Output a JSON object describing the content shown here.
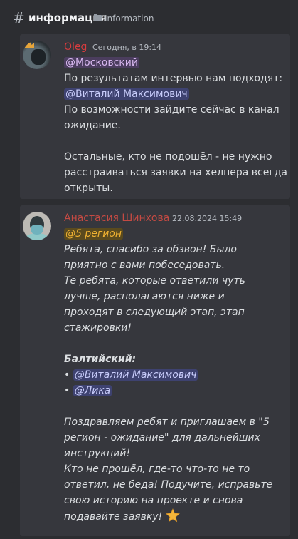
{
  "header": {
    "hash": "#",
    "channel_name": "информация",
    "topic": "Information",
    "folder_icon": "folder-icon"
  },
  "messages": [
    {
      "author": "Oleg",
      "author_color": "#d83c3e",
      "timestamp": "Сегодня, в 19:14",
      "lines": [
        {
          "mention": "@Московский"
        },
        {
          "text": "По результатам интервью нам подходят:"
        },
        {
          "mention": "@Виталий Максимович"
        },
        {
          "text": "По возможности зайдите сейчас в канал"
        },
        {
          "text": "ожидание."
        },
        {
          "text": ""
        },
        {
          "text": "Остальные, кто не подошёл - не нужно"
        },
        {
          "text": "расстраиваться заявки на хелпера всегда"
        },
        {
          "text": "открыты."
        }
      ]
    },
    {
      "author": "Анастасия Шинхова",
      "author_color": "#c44a43",
      "timestamp": "22.08.2024 15:49",
      "lines": [
        {
          "mention": "@5 регион"
        },
        {
          "text": "Ребята, спасибо за обзвон! Было"
        },
        {
          "text": "приятно с вами побеседовать."
        },
        {
          "text": "Те ребята, которые ответили чуть"
        },
        {
          "text": "лучше, располагаются ниже и"
        },
        {
          "text": "проходят в следующий этап, этап"
        },
        {
          "text": "стажировки!"
        },
        {
          "text": ""
        },
        {
          "text": "Балтийский:"
        },
        {
          "bullet": "•",
          "mention": "@Виталий Максимович"
        },
        {
          "bullet": "•",
          "mention": "@Лика"
        },
        {
          "text": ""
        },
        {
          "text": "Поздравляем ребят и приглашаем в \"5"
        },
        {
          "text": "регион - ожидание\" для дальнейших"
        },
        {
          "text": "инструкций!"
        },
        {
          "text": "Кто не прошёл, где-то что-то не то"
        },
        {
          "text": "ответил, не беда! Подучите, исправьте"
        },
        {
          "text": "свою историю на проекте и снова"
        },
        {
          "text": "подавайте заявку!",
          "emoji": "star"
        }
      ]
    }
  ]
}
